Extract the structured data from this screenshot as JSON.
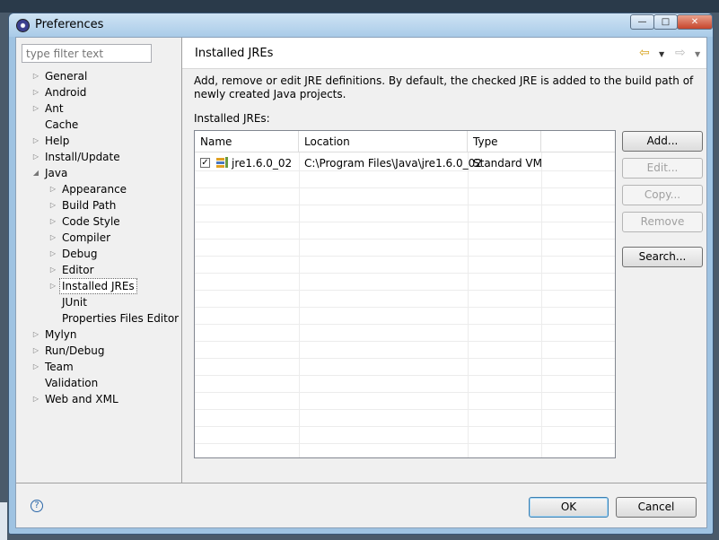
{
  "window": {
    "title": "Preferences"
  },
  "filter": {
    "placeholder": "type filter text"
  },
  "tree": {
    "items": [
      {
        "label": "General",
        "indent": 0,
        "expander": "closed"
      },
      {
        "label": "Android",
        "indent": 0,
        "expander": "closed"
      },
      {
        "label": "Ant",
        "indent": 0,
        "expander": "closed"
      },
      {
        "label": "Cache",
        "indent": 0,
        "expander": "none"
      },
      {
        "label": "Help",
        "indent": 0,
        "expander": "closed"
      },
      {
        "label": "Install/Update",
        "indent": 0,
        "expander": "closed"
      },
      {
        "label": "Java",
        "indent": 0,
        "expander": "open"
      },
      {
        "label": "Appearance",
        "indent": 1,
        "expander": "closed"
      },
      {
        "label": "Build Path",
        "indent": 1,
        "expander": "closed"
      },
      {
        "label": "Code Style",
        "indent": 1,
        "expander": "closed"
      },
      {
        "label": "Compiler",
        "indent": 1,
        "expander": "closed"
      },
      {
        "label": "Debug",
        "indent": 1,
        "expander": "closed"
      },
      {
        "label": "Editor",
        "indent": 1,
        "expander": "closed"
      },
      {
        "label": "Installed JREs",
        "indent": 1,
        "expander": "closed",
        "selected": true
      },
      {
        "label": "JUnit",
        "indent": 1,
        "expander": "none"
      },
      {
        "label": "Properties Files Editor",
        "indent": 1,
        "expander": "none"
      },
      {
        "label": "Mylyn",
        "indent": 0,
        "expander": "closed"
      },
      {
        "label": "Run/Debug",
        "indent": 0,
        "expander": "closed"
      },
      {
        "label": "Team",
        "indent": 0,
        "expander": "closed"
      },
      {
        "label": "Validation",
        "indent": 0,
        "expander": "none"
      },
      {
        "label": "Web and XML",
        "indent": 0,
        "expander": "closed"
      }
    ]
  },
  "page": {
    "title": "Installed JREs",
    "description": "Add, remove or edit JRE definitions. By default, the checked JRE is added to the build path of newly created Java projects.",
    "table_label": "Installed JREs:"
  },
  "table": {
    "columns": [
      "Name",
      "Location",
      "Type"
    ],
    "rows": [
      {
        "name": "jre1.6.0_02",
        "location": "C:\\Program Files\\Java\\jre1.6.0_02",
        "type": "Standard VM",
        "checked": true
      }
    ]
  },
  "buttons": {
    "add": "Add...",
    "edit": "Edit...",
    "copy": "Copy...",
    "remove": "Remove",
    "search": "Search...",
    "ok": "OK",
    "cancel": "Cancel"
  },
  "icons": {
    "back": "back-arrow-icon",
    "forward": "forward-arrow-icon",
    "help": "help-icon"
  },
  "colors": {
    "titlebar": "#a9cbe8",
    "close_button": "#c6452c",
    "back_arrow": "#d6a21c"
  }
}
